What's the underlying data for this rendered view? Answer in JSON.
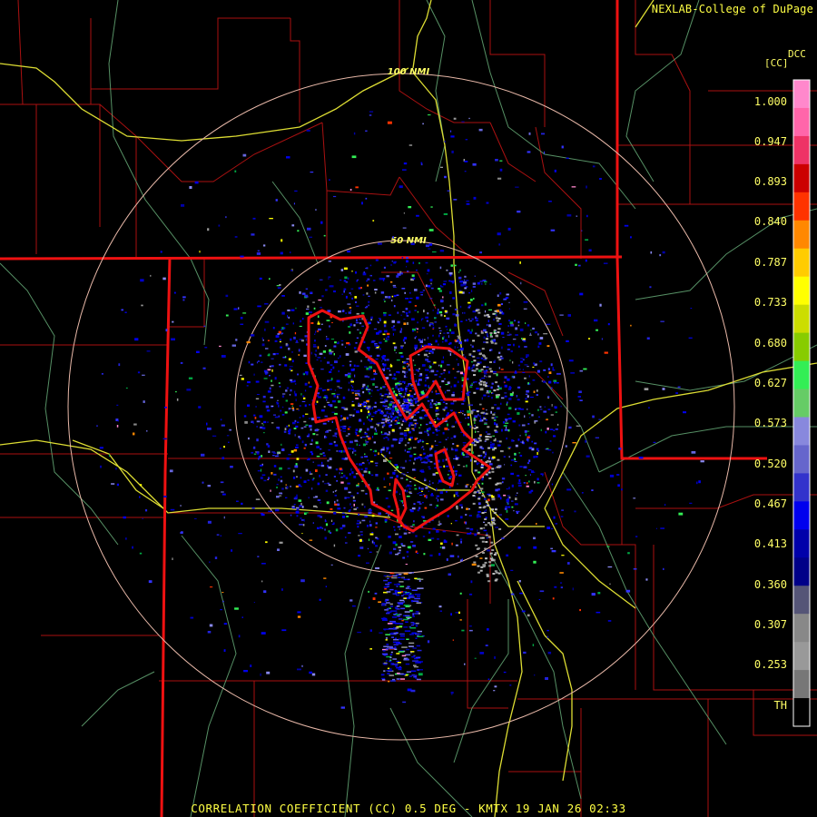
{
  "header": {
    "credit": "NEXLAB-College of DuPage"
  },
  "legend": {
    "title": "DCC",
    "unit": "[CC]",
    "labels": [
      "1.000",
      "0.947",
      "0.893",
      "0.840",
      "0.787",
      "0.733",
      "0.680",
      "0.627",
      "0.573",
      "0.520",
      "0.467",
      "0.413",
      "0.360",
      "0.307",
      "0.253",
      "TH"
    ],
    "colors": [
      "#ff88cc",
      "#ff66aa",
      "#ee3366",
      "#cc0000",
      "#ff3300",
      "#ff8800",
      "#ffcc00",
      "#ffff00",
      "#ccdd00",
      "#88cc00",
      "#33ee55",
      "#66cc66",
      "#8888dd",
      "#6666cc",
      "#3333cc",
      "#0000ee",
      "#0000aa",
      "#000088",
      "#555577",
      "#888888",
      "#999999",
      "#777777",
      "#000000"
    ]
  },
  "range_rings": [
    {
      "label": "100 NMI",
      "radius_nmi": 100
    },
    {
      "label": "50 NMI",
      "radius_nmi": 50
    }
  ],
  "footer": {
    "caption": "CORRELATION COEFFICIENT (CC) 0.5 DEG - KMTX 19 JAN 26 02:33"
  }
}
